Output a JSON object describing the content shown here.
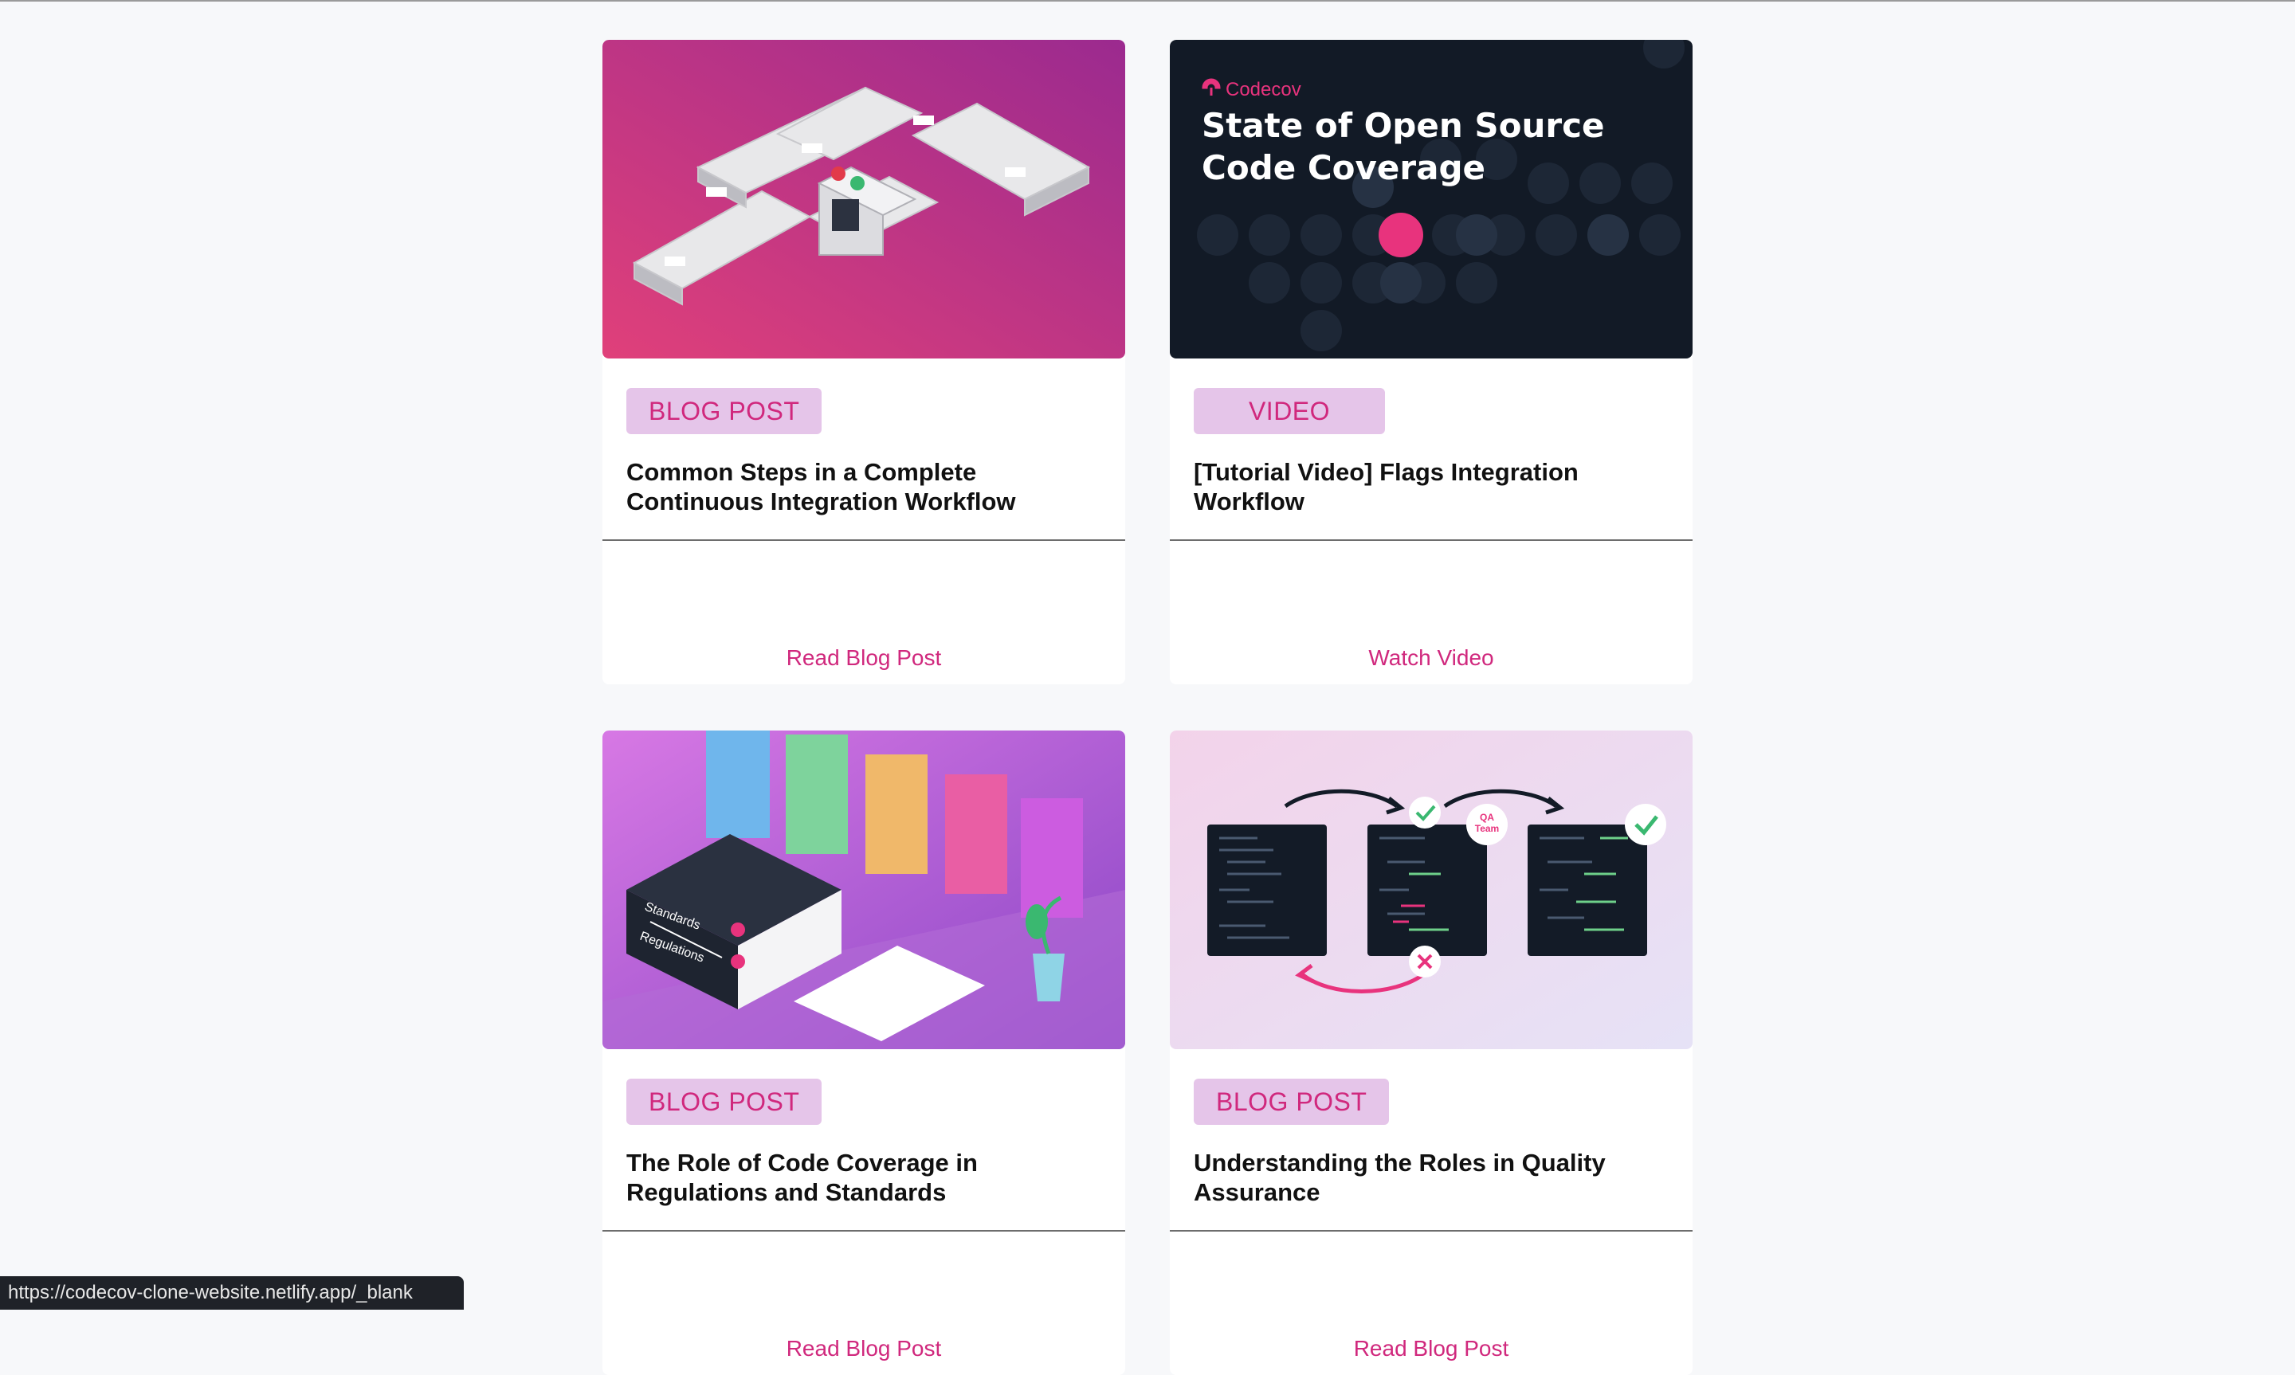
{
  "cards": [
    {
      "badge": "BLOG POST",
      "title": "Common Steps in a Complete Continuous Integration Workflow",
      "action": "Read Blog Post"
    },
    {
      "badge": "VIDEO",
      "title": "[Tutorial Video] Flags Integration Workflow",
      "action": "Watch Video",
      "thumb": {
        "brand": "Codecov",
        "heading_line1": "State of Open Source",
        "heading_line2": "Code Coverage"
      }
    },
    {
      "badge": "BLOG POST",
      "title": "The Role of Code Coverage in Regulations and Standards",
      "action": "Read Blog Post",
      "thumb": {
        "book1": "Standards",
        "book2": "Regulations"
      }
    },
    {
      "badge": "BLOG POST",
      "title": "Understanding the Roles in Quality Assurance",
      "action": "Read Blog Post",
      "thumb": {
        "qa_label_line1": "QA",
        "qa_label_line2": "Team"
      }
    }
  ],
  "status_bar": {
    "url": "https://codecov-clone-website.netlify.app/_blank"
  },
  "colors": {
    "accent": "#d0287d",
    "badge_bg": "#e5c5e9",
    "dark_navy": "#121a26"
  }
}
